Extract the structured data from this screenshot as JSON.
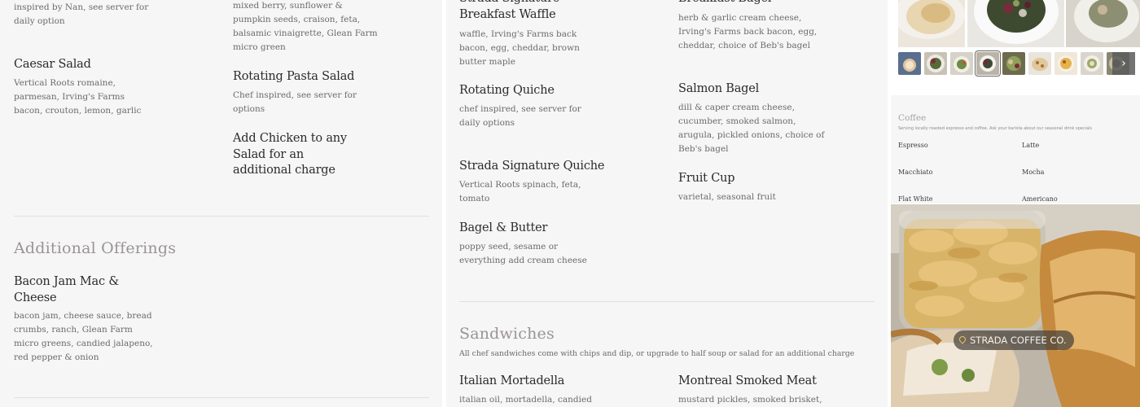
{
  "left": {
    "salads": [
      {
        "title": "",
        "desc": "inspired by Nan, see server for daily option"
      },
      {
        "title": "",
        "desc": "mixed berry, sunflower & pumpkin seeds, craison, feta, balsamic vinaigrette, Glean Farm micro green"
      },
      {
        "title": "Caesar Salad",
        "desc": "Vertical Roots romaine, parmesan, Irving's Farms bacon, crouton, lemon, garlic"
      },
      {
        "title": "Rotating Pasta Salad",
        "desc": "Chef inspired, see server for options"
      },
      {
        "title": "Add Chicken to any Salad for an additional charge",
        "desc": ""
      }
    ],
    "additional": {
      "title": "Additional Offerings",
      "items": [
        {
          "title": "Bacon Jam Mac & Cheese",
          "desc": "bacon jam, cheese sauce, bread crumbs, ranch, Glean Farm micro greens, candied jalapeno, red pepper & onion"
        }
      ]
    }
  },
  "mid": {
    "breakfast": [
      {
        "title": "Strada Signature Breakfast Waffle",
        "desc": "waffle, Irving's Farms back bacon, egg, cheddar, brown butter maple"
      },
      {
        "title": "Breakfast Bagel",
        "desc": "herb & garlic cream cheese, Irving's Farms back bacon, egg, cheddar, choice of Beb's bagel"
      },
      {
        "title": "Rotating Quiche",
        "desc": "chef inspired, see server for daily options"
      },
      {
        "title": "Salmon Bagel",
        "desc": "dill & caper cream cheese, cucumber, smoked salmon, arugula, pickled onions, choice of Beb's bagel"
      },
      {
        "title": "Strada Signature Quiche",
        "desc": "Vertical Roots spinach, feta, tomato"
      },
      {
        "title": "Fruit Cup",
        "desc": "varietal, seasonal fruit"
      },
      {
        "title": "Bagel & Butter",
        "desc": "poppy seed, sesame or everything add cream cheese"
      }
    ],
    "sandwiches": {
      "title": "Sandwiches",
      "note": "All chef sandwiches come with chips and dip, or upgrade to half soup or salad for an additional charge",
      "items": [
        {
          "title": "Italian Mortadella",
          "desc": "italian oil, mortadella, candied"
        },
        {
          "title": "Montreal Smoked Meat",
          "desc": "mustard pickles, smoked brisket,"
        }
      ]
    }
  },
  "gallery": {
    "next_icon": "chevron-right-icon",
    "thumbs": [
      "coffee",
      "plate",
      "salad",
      "bowl",
      "salad",
      "pastry",
      "soup",
      "dish",
      "plate",
      "more"
    ]
  },
  "coffee": {
    "title": "Coffee",
    "note": "Serving locally roasted espresso and coffee. Ask your barista about our seasonal drink specials",
    "items": [
      "Espresso",
      "Latte",
      "Macchiato",
      "Mocha",
      "Flat White",
      "Americano"
    ]
  },
  "photo": {
    "badge": "STRADA COFFEE CO.",
    "badge_icon": "map-pin-icon"
  },
  "colors": {
    "panel_bg": "#f6f6f6",
    "section_title": "#9a9494",
    "badge_bg": "#46413c",
    "pin": "#e8c468"
  }
}
